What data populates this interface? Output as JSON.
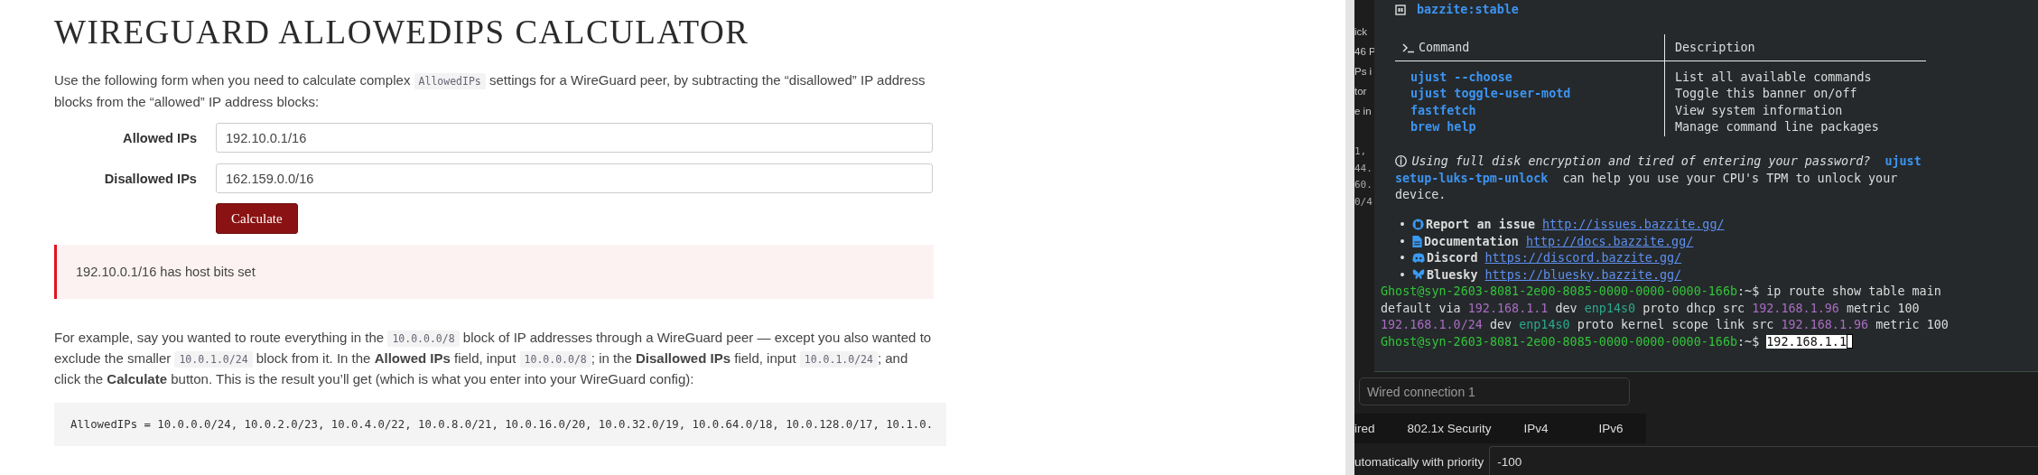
{
  "page": {
    "title": "WIREGUARD ALLOWEDIPS CALCULATOR",
    "intro": [
      {
        "kind": "text",
        "text": "Use the following form when you need to calculate complex "
      },
      {
        "kind": "code",
        "text": "AllowedIPs"
      },
      {
        "kind": "text",
        "text": " settings for a WireGuard peer, by subtracting the “disallowed” IP address blocks from the “allowed” IP address blocks:"
      }
    ],
    "fields": [
      {
        "label": "Allowed IPs",
        "value": "192.10.0.1/16"
      },
      {
        "label": "Disallowed IPs",
        "value": "162.159.0.0/16"
      }
    ],
    "button": "Calculate",
    "alert": "192.10.0.1/16 has host bits set",
    "example": [
      {
        "kind": "text",
        "text": "For example, say you wanted to route everything in the "
      },
      {
        "kind": "code",
        "text": "10.0.0.0/8"
      },
      {
        "kind": "text",
        "text": " block of IP addresses through a WireGuard peer — except you also wanted to exclude the smaller "
      },
      {
        "kind": "code",
        "text": "10.0.1.0/24"
      },
      {
        "kind": "text",
        "text": " block from it. In the **Allowed IPs** field, input "
      },
      {
        "kind": "code",
        "text": "10.0.0.0/8"
      },
      {
        "kind": "text",
        "text": "; in the **Disallowed IPs** field, input "
      },
      {
        "kind": "code",
        "text": "10.0.1.0/24"
      },
      {
        "kind": "text",
        "text": "; and click the **Calculate** button. This is the result you’ll get (which is what you enter into your WireGuard config):"
      }
    ],
    "result": "AllowedIPs = 10.0.0.0/24, 10.0.2.0/23, 10.0.4.0/22, 10.0.8.0/21, 10.0.16.0/20, 10.0.32.0/19, 10.0.64.0/18, 10.0.128.0/17, 10.1.0."
  },
  "background_app": {
    "chat_fragments": [
      "ick",
      "46 P",
      "Ps i",
      "tor",
      "e in"
    ],
    "code_fragments": [
      "1,",
      "44.",
      "60.",
      "0/4"
    ],
    "connection_field": {
      "value": "Wired connection 1"
    },
    "tabs": [
      "ired",
      "802.1x Security",
      "IPv4",
      "IPv6"
    ],
    "priority": {
      "label": "utomatically with priority",
      "value": "-100"
    }
  },
  "terminal": {
    "image_tag": "bazzite:stable",
    "columns": [
      "Command",
      "Description"
    ],
    "rows": [
      {
        "command": "ujust --choose",
        "description": "List all available commands"
      },
      {
        "command": "ujust toggle-user-motd",
        "description": "Toggle this banner on/off"
      },
      {
        "command": "fastfetch",
        "description": "View system information"
      },
      {
        "command": "brew help",
        "description": "Manage command line packages"
      }
    ],
    "note": [
      {
        "kind": "glyph",
        "text": "ⓘ"
      },
      {
        "kind": "italic",
        "text": "Using full disk encryption and tired of entering your password?"
      },
      {
        "kind": "command",
        "text": "ujust setup-luks-tpm-unlock"
      },
      {
        "kind": "plain",
        "text": "  can help you use your CPU's TPM to unlock your device."
      }
    ],
    "links": [
      {
        "bullet": "•",
        "kind": "github",
        "label": "Report an issue",
        "url": "http://issues.bazzite.gg/"
      },
      {
        "bullet": "•",
        "kind": "docs",
        "label": "Documentation",
        "url": "http://docs.bazzite.gg/"
      },
      {
        "bullet": "•",
        "kind": "discord",
        "label": "Discord",
        "url": "https://discord.bazzite.gg/"
      },
      {
        "bullet": "•",
        "kind": "bluesky",
        "label": "Bluesky",
        "url": "https://bluesky.bazzite.gg/"
      }
    ],
    "lines": [
      [
        {
          "kind": "prompt",
          "text": "Ghost@syn-2603-8081-2e00-8085-0000-0000-0000-166b"
        },
        {
          "kind": "plain",
          "text": ":~$ ip route show table main"
        }
      ],
      [
        {
          "kind": "plain",
          "text": "default via "
        },
        {
          "kind": "ip",
          "text": "192.168.1.1"
        },
        {
          "kind": "plain",
          "text": " dev "
        },
        {
          "kind": "iface",
          "text": "enp14s0"
        },
        {
          "kind": "plain",
          "text": " proto dhcp src "
        },
        {
          "kind": "ip",
          "text": "192.168.1.96"
        },
        {
          "kind": "plain",
          "text": " metric 100"
        }
      ],
      [
        {
          "kind": "ip",
          "text": "192.168.1.0/24"
        },
        {
          "kind": "plain",
          "text": " dev "
        },
        {
          "kind": "iface",
          "text": "enp14s0"
        },
        {
          "kind": "plain",
          "text": " proto kernel scope link src "
        },
        {
          "kind": "ip",
          "text": "192.168.1.96"
        },
        {
          "kind": "plain",
          "text": " metric 100"
        }
      ],
      [
        {
          "kind": "prompt",
          "text": "Ghost@syn-2603-8081-2e00-8085-0000-0000-0000-166b"
        },
        {
          "kind": "plain",
          "text": ":~$ "
        },
        {
          "kind": "selected",
          "text": "192.168.1.1"
        },
        {
          "kind": "cursor"
        }
      ]
    ]
  }
}
